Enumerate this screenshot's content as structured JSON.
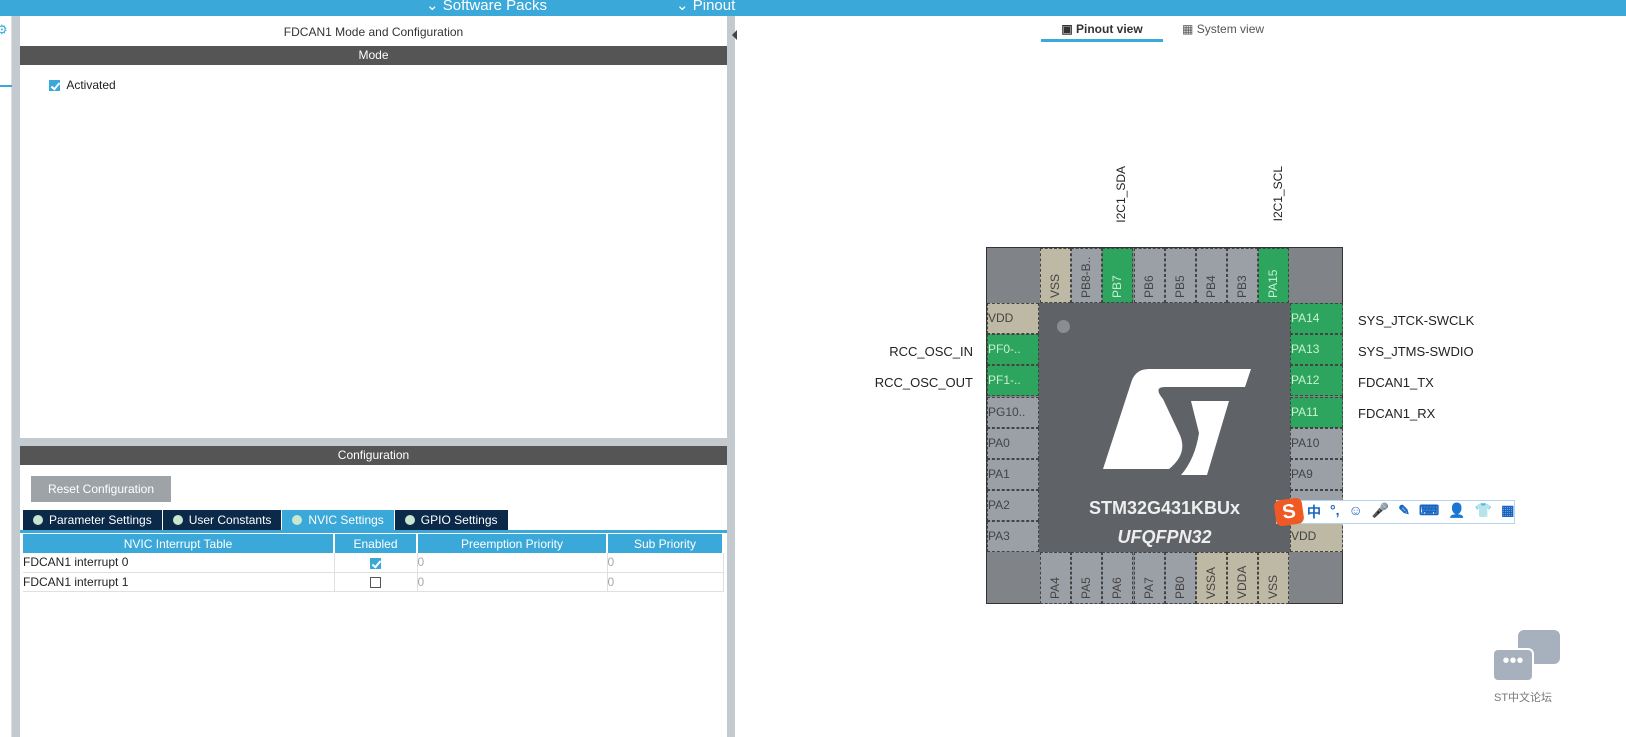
{
  "topbar": {
    "software_packs": "Software Packs",
    "pinout": "Pinout"
  },
  "left": {
    "title": "FDCAN1 Mode and Configuration",
    "mode_header": "Mode",
    "activated_label": "Activated",
    "activated": true,
    "config_header": "Configuration",
    "reset_button": "Reset Configuration",
    "tabs": [
      {
        "label": "Parameter Settings",
        "active": false
      },
      {
        "label": "User Constants",
        "active": false
      },
      {
        "label": "NVIC Settings",
        "active": true
      },
      {
        "label": "GPIO Settings",
        "active": false
      }
    ],
    "table": {
      "headers": [
        "NVIC Interrupt Table",
        "Enabled",
        "Preemption Priority",
        "Sub Priority"
      ],
      "rows": [
        {
          "name": "FDCAN1 interrupt 0",
          "enabled": true,
          "preemption": "0",
          "sub": "0"
        },
        {
          "name": "FDCAN1 interrupt 1",
          "enabled": false,
          "preemption": "0",
          "sub": "0"
        }
      ]
    }
  },
  "right": {
    "views": [
      {
        "label": "Pinout view",
        "active": true
      },
      {
        "label": "System view",
        "active": false
      }
    ],
    "chip": {
      "name": "STM32G431KBUx",
      "package": "UFQFPN32",
      "top_pins": [
        {
          "n": "VSS",
          "t": "b"
        },
        {
          "n": "PB8-B..",
          "t": "x"
        },
        {
          "n": "PB7",
          "t": "g"
        },
        {
          "n": "PB6",
          "t": "x"
        },
        {
          "n": "PB5",
          "t": "x"
        },
        {
          "n": "PB4",
          "t": "x"
        },
        {
          "n": "PB3",
          "t": "x"
        },
        {
          "n": "PA15",
          "t": "g"
        }
      ],
      "left_pins": [
        {
          "n": "VDD",
          "t": "b"
        },
        {
          "n": "PF0-..",
          "t": "g"
        },
        {
          "n": "PF1-..",
          "t": "g"
        },
        {
          "n": "PG10..",
          "t": "x"
        },
        {
          "n": "PA0",
          "t": "x"
        },
        {
          "n": "PA1",
          "t": "x"
        },
        {
          "n": "PA2",
          "t": "x"
        },
        {
          "n": "PA3",
          "t": "x"
        }
      ],
      "right_pins": [
        {
          "n": "PA14",
          "t": "g"
        },
        {
          "n": "PA13",
          "t": "g"
        },
        {
          "n": "PA12",
          "t": "g"
        },
        {
          "n": "PA11",
          "t": "g"
        },
        {
          "n": "PA10",
          "t": "x"
        },
        {
          "n": "PA9",
          "t": "x"
        },
        {
          "n": "",
          "t": "x"
        },
        {
          "n": "VDD",
          "t": "b"
        }
      ],
      "bottom_pins": [
        {
          "n": "PA4",
          "t": "x"
        },
        {
          "n": "PA5",
          "t": "x"
        },
        {
          "n": "PA6",
          "t": "x"
        },
        {
          "n": "PA7",
          "t": "x"
        },
        {
          "n": "PB0",
          "t": "x"
        },
        {
          "n": "VSSA",
          "t": "b"
        },
        {
          "n": "VDDA",
          "t": "b"
        },
        {
          "n": "VSS",
          "t": "b"
        }
      ]
    },
    "signals": {
      "top": [
        "I2C1_SDA",
        "I2C1_SCL"
      ],
      "left": [
        "RCC_OSC_IN",
        "RCC_OSC_OUT"
      ],
      "right": [
        "SYS_JTCK-SWCLK",
        "SYS_JTMS-SWDIO",
        "FDCAN1_TX",
        "FDCAN1_RX"
      ]
    }
  },
  "ime": {
    "items": [
      "中",
      "°,",
      "☺",
      "🎤",
      "✎",
      "⌨",
      "👤",
      "👕",
      "▦"
    ]
  },
  "forum": {
    "label": "ST中文论坛"
  }
}
